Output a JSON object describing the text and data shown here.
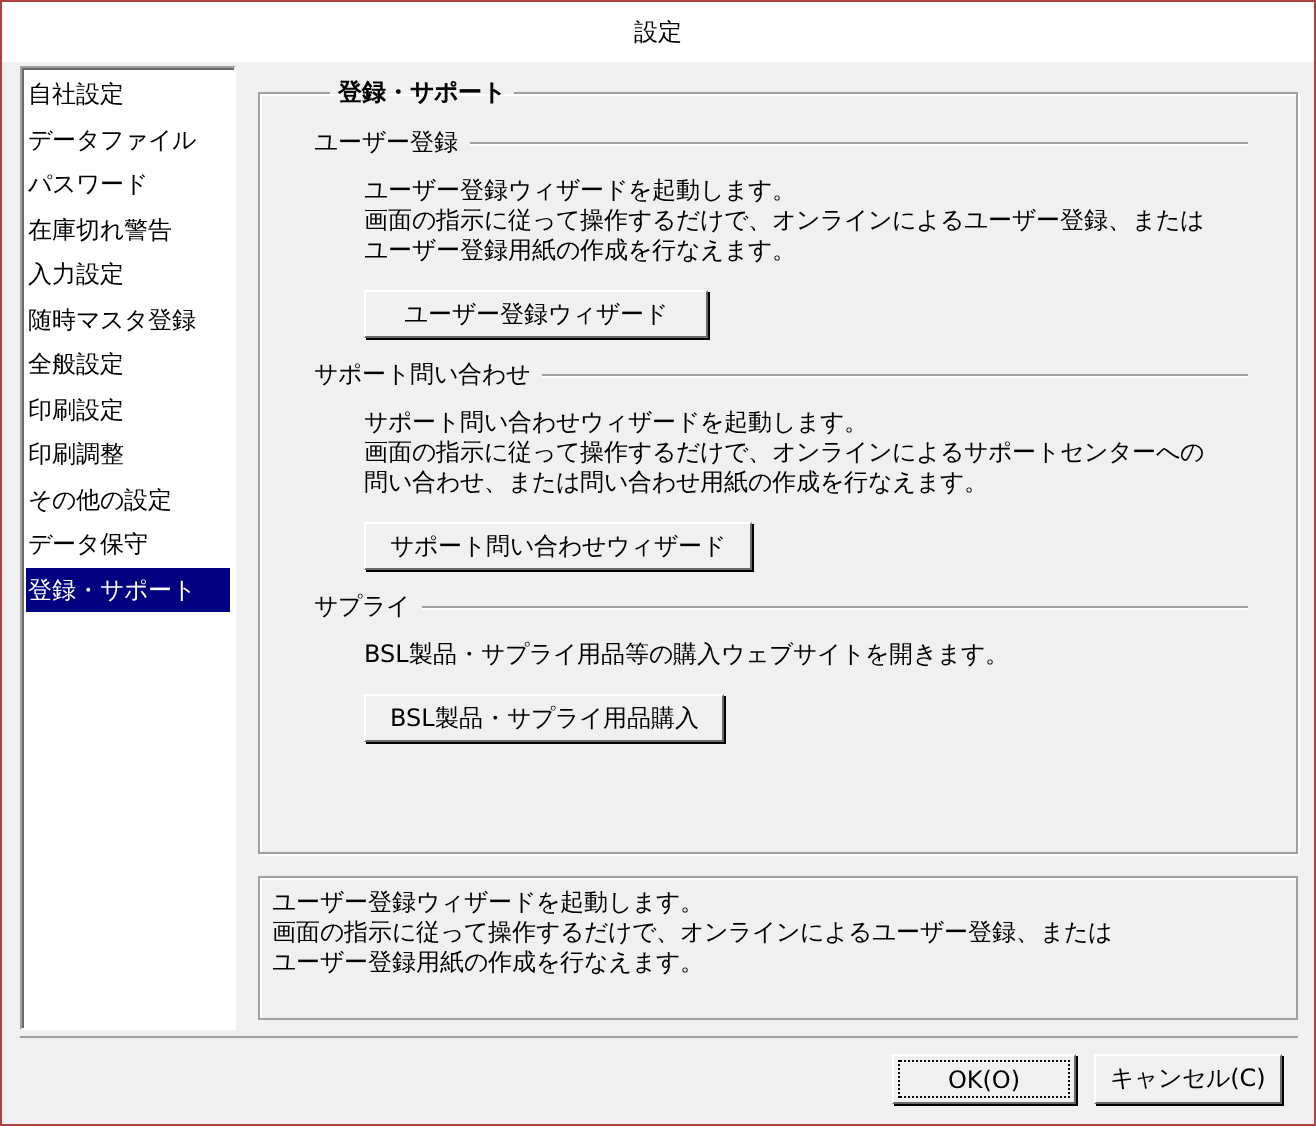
{
  "window": {
    "title": "設定"
  },
  "sidebar": {
    "items": [
      {
        "label": "自社設定",
        "selected": false
      },
      {
        "label": "データファイル",
        "selected": false
      },
      {
        "label": "パスワード",
        "selected": false
      },
      {
        "label": "在庫切れ警告",
        "selected": false
      },
      {
        "label": "入力設定",
        "selected": false
      },
      {
        "label": "随時マスタ登録",
        "selected": false
      },
      {
        "label": "全般設定",
        "selected": false
      },
      {
        "label": "印刷設定",
        "selected": false
      },
      {
        "label": "印刷調整",
        "selected": false
      },
      {
        "label": "その他の設定",
        "selected": false
      },
      {
        "label": "データ保守",
        "selected": false
      },
      {
        "label": "登録・サポート",
        "selected": true
      }
    ]
  },
  "panel": {
    "title": "登録・サポート",
    "sections": [
      {
        "title": "ユーザー登録",
        "description": [
          "ユーザー登録ウィザードを起動します。",
          "画面の指示に従って操作するだけで、オンラインによるユーザー登録、または",
          "ユーザー登録用紙の作成を行なえます。"
        ],
        "button": "ユーザー登録ウィザード"
      },
      {
        "title": "サポート問い合わせ",
        "description": [
          "サポート問い合わせウィザードを起動します。",
          "画面の指示に従って操作するだけで、オンラインによるサポートセンターへの",
          "問い合わせ、または問い合わせ用紙の作成を行なえます。"
        ],
        "button": "サポート問い合わせウィザード"
      },
      {
        "title": "サプライ",
        "description": [
          "BSL製品・サプライ用品等の購入ウェブサイトを開きます。"
        ],
        "button": "BSL製品・サプライ用品購入"
      }
    ]
  },
  "help_text": [
    "ユーザー登録ウィザードを起動します。",
    "画面の指示に従って操作するだけで、オンラインによるユーザー登録、または",
    "ユーザー登録用紙の作成を行なえます。"
  ],
  "buttons": [
    {
      "label": "OK(O)",
      "kind": "default"
    },
    {
      "label": "キャンセル(C)",
      "kind": "normal"
    }
  ]
}
